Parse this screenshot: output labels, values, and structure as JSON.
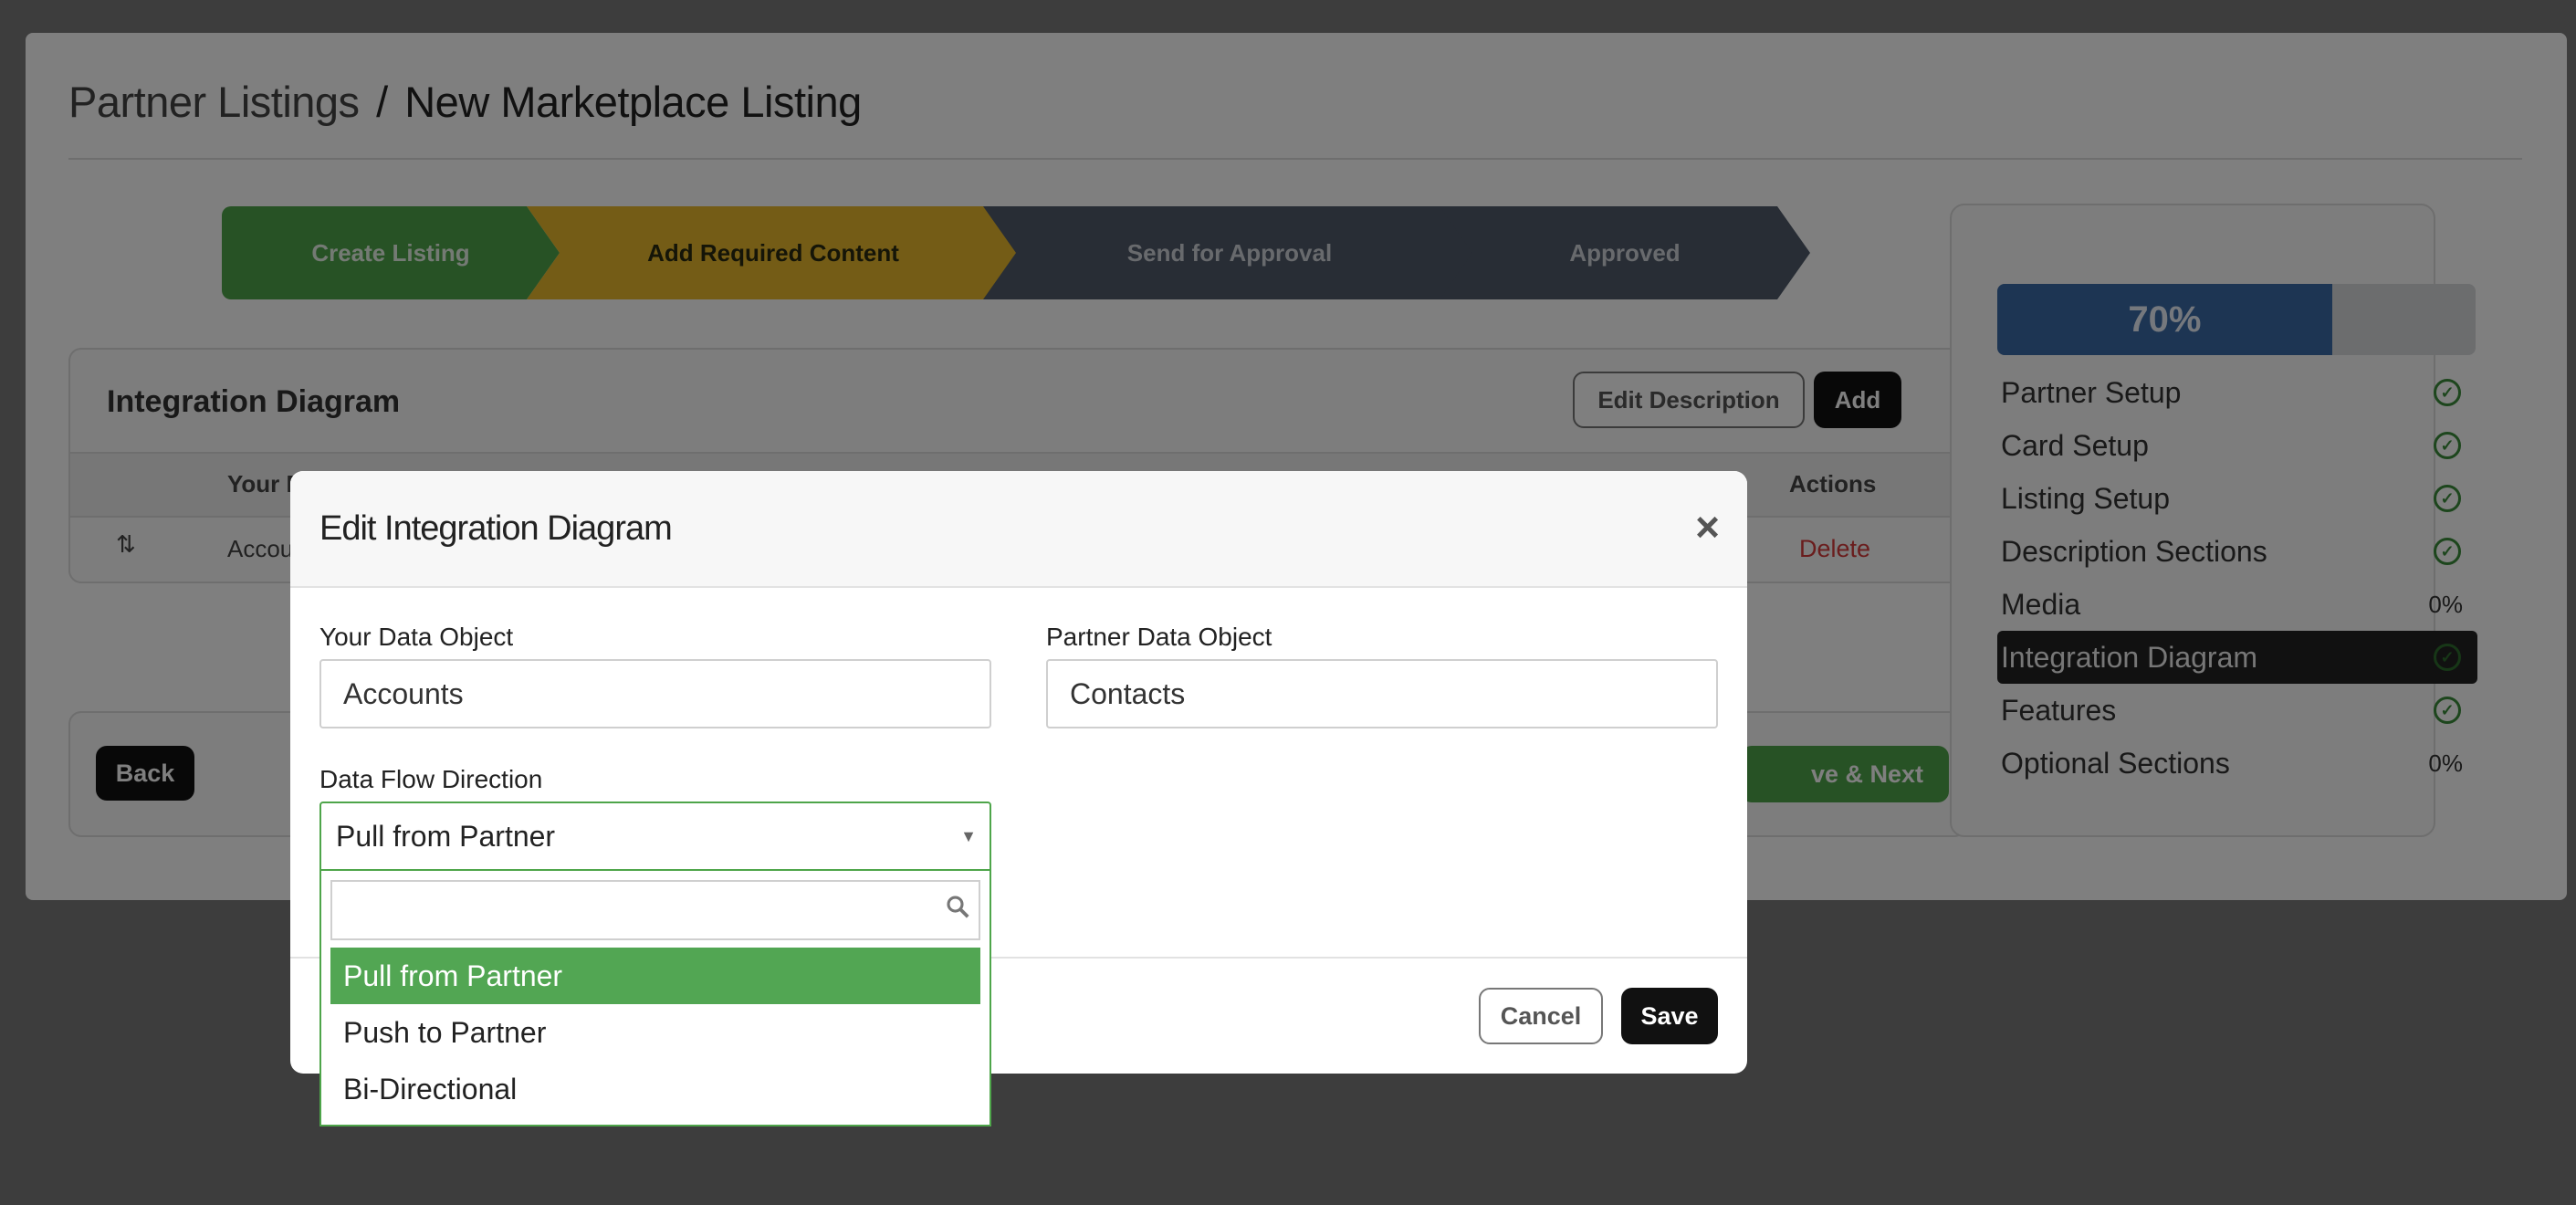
{
  "breadcrumb": {
    "parent": "Partner Listings",
    "separator": "/",
    "current": "New Marketplace Listing"
  },
  "steps": [
    {
      "label": "Create Listing",
      "state": "complete"
    },
    {
      "label": "Add Required Content",
      "state": "current"
    },
    {
      "label": "Send for Approval",
      "state": "pending"
    },
    {
      "label": "Approved",
      "state": "pending"
    }
  ],
  "card": {
    "title": "Integration Diagram",
    "edit_description_label": "Edit Description",
    "add_label": "Add",
    "col_your": "Your D",
    "col_actions": "Actions",
    "row_sort_icon": "sort-icon",
    "row_object": "Accou",
    "row_delete": "Delete"
  },
  "nav": {
    "back_label": "Back",
    "save_next_label": "ve & Next"
  },
  "progress": {
    "percent_label": "70%",
    "value": 0.7,
    "items": [
      {
        "label": "Partner Setup",
        "status": "check"
      },
      {
        "label": "Card Setup",
        "status": "check"
      },
      {
        "label": "Listing Setup",
        "status": "check"
      },
      {
        "label": "Description Sections",
        "status": "check"
      },
      {
        "label": "Media",
        "status": "0%"
      },
      {
        "label": "Integration Diagram",
        "status": "check",
        "active": true
      },
      {
        "label": "Features",
        "status": "check"
      },
      {
        "label": "Optional Sections",
        "status": "0%"
      }
    ]
  },
  "modal": {
    "title": "Edit Integration Diagram",
    "close": "×",
    "your_label": "Your Data Object",
    "your_value": "Accounts",
    "partner_label": "Partner Data Object",
    "partner_value": "Contacts",
    "flow_label": "Data Flow Direction",
    "flow_value": "Pull from Partner",
    "flow_options": [
      "Pull from Partner",
      "Push to Partner",
      "Bi-Directional"
    ],
    "cancel_label": "Cancel",
    "save_label": "Save"
  },
  "colors": {
    "step_complete": "#4ea54a",
    "step_current": "#e8b82c",
    "step_pending": "#505a6a",
    "progress_fill": "#3a6aa6",
    "option_selected": "#52a653",
    "delete": "#d43a3a"
  }
}
